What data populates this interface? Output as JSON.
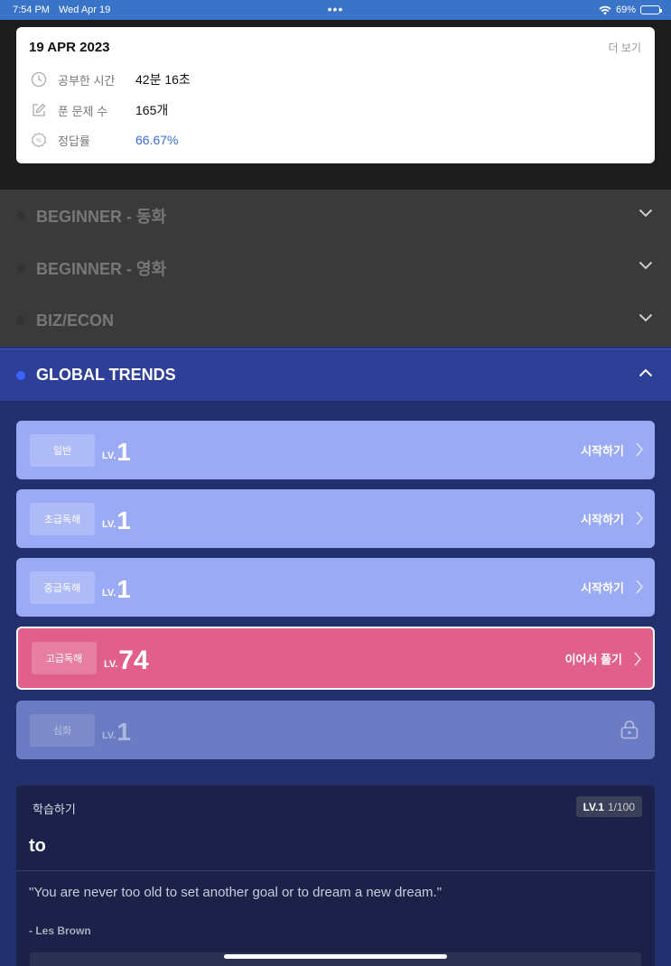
{
  "status_bar": {
    "time": "7:54 PM",
    "date": "Wed Apr 19",
    "dots": "•••",
    "battery": "69%"
  },
  "stats": {
    "date": "19 APR 2023",
    "more": "더 보기",
    "rows": [
      {
        "icon": "clock-icon",
        "label": "공부한 시간",
        "value": "42분 16초"
      },
      {
        "icon": "edit-icon",
        "label": "푼 문제 수",
        "value": "165개"
      },
      {
        "icon": "percent-badge-icon",
        "label": "정답률",
        "value": "66.67%"
      }
    ]
  },
  "categories": [
    {
      "title": "BEGINNER - 동화"
    },
    {
      "title": "BEGINNER - 영화"
    },
    {
      "title": "BIZ/ECON"
    }
  ],
  "global": {
    "title": "GLOBAL TRENDS",
    "levels": [
      {
        "tag": "일반",
        "lv": "LV.",
        "num": "1",
        "action": "시작하기"
      },
      {
        "tag": "초급독해",
        "lv": "LV.",
        "num": "1",
        "action": "시작하기"
      },
      {
        "tag": "중급독해",
        "lv": "LV.",
        "num": "1",
        "action": "시작하기"
      },
      {
        "tag": "고급독해",
        "lv": "LV.",
        "num": "74",
        "action": "이어서 풀기"
      },
      {
        "tag": "심화",
        "lv": "LV.",
        "num": "1",
        "action": ""
      }
    ]
  },
  "study": {
    "heading": "학습하기",
    "badge_level": "LV.1",
    "badge_progress": "1/100",
    "word": "to",
    "quote": "\"You are never too old to set another goal or to dream a new dream.\"",
    "author": "- Les Brown"
  },
  "colors": {
    "accent_blue": "#3d63ff",
    "active_card": "#e0608b",
    "level_card": "#9aaaf4"
  }
}
